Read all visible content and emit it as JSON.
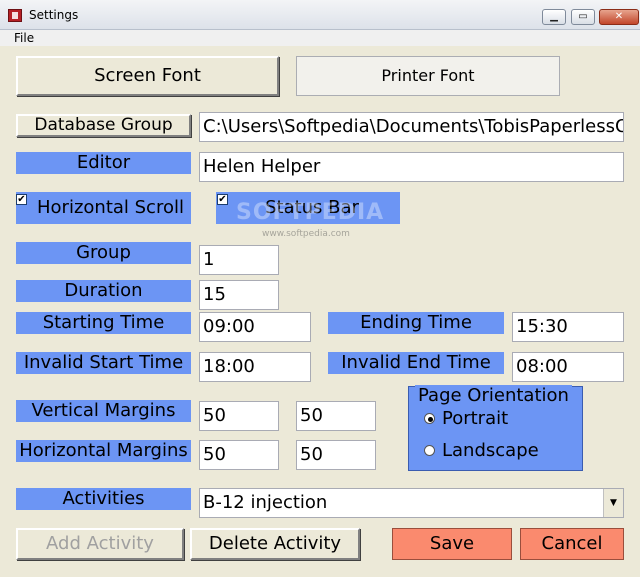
{
  "window": {
    "title": "Settings",
    "min": "▁",
    "max": "▭",
    "close": "✕"
  },
  "menu": {
    "file": "File"
  },
  "fonts": {
    "screen": "Screen Font",
    "printer": "Printer Font"
  },
  "database": {
    "button": "Database Group",
    "path": "C:\\Users\\Softpedia\\Documents\\TobisPaperlessOffice"
  },
  "editor": {
    "label": "Editor",
    "value": "Helen Helper"
  },
  "options": {
    "hscroll": "Horizontal Scroll",
    "statusbar": "Status Bar",
    "check": "✔"
  },
  "group": {
    "label": "Group",
    "value": "1"
  },
  "duration": {
    "label": "Duration",
    "value": "15"
  },
  "times": {
    "start_label": "Starting Time",
    "start_value": "09:00",
    "end_label": "Ending Time",
    "end_value": "15:30",
    "invalid_start_label": "Invalid Start Time",
    "invalid_start_value": "18:00",
    "invalid_end_label": "Invalid End Time",
    "invalid_end_value": "08:00"
  },
  "margins": {
    "vertical_label": "Vertical Margins",
    "v1": "50",
    "v2": "50",
    "horizontal_label": "Horizontal Margins",
    "h1": "50",
    "h2": "50"
  },
  "orientation": {
    "title": "Page Orientation",
    "portrait": "Portrait",
    "landscape": "Landscape",
    "selected": "Portrait"
  },
  "activities": {
    "label": "Activities",
    "value": "B-12 injection",
    "arrow": "▼"
  },
  "actions": {
    "add": "Add Activity",
    "delete": "Delete Activity",
    "save": "Save",
    "cancel": "Cancel"
  },
  "watermark": {
    "text": "SOFTPEDIA",
    "sub": "www.softpedia.com"
  }
}
